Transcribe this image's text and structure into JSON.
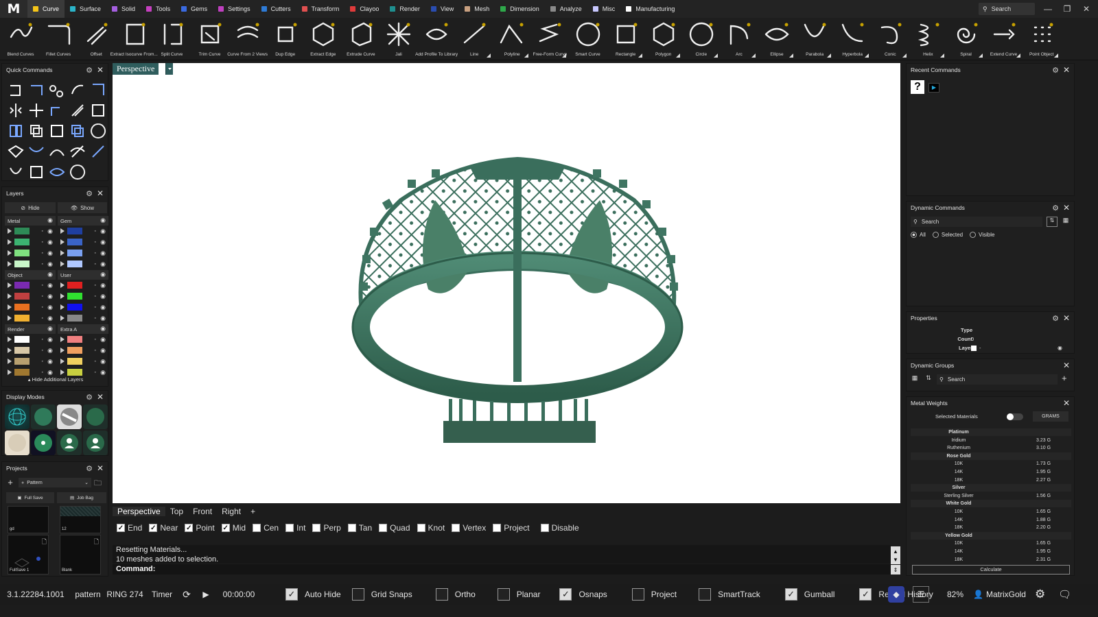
{
  "app": {
    "logo": "M"
  },
  "menu": [
    {
      "label": "Curve",
      "color": "#f5c518",
      "active": true
    },
    {
      "label": "Surface",
      "color": "#2bb4c9"
    },
    {
      "label": "Solid",
      "color": "#a55fe0"
    },
    {
      "label": "Tools",
      "color": "#c640c0"
    },
    {
      "label": "Gems",
      "color": "#3a6ae0"
    },
    {
      "label": "Settings",
      "color": "#c040c0"
    },
    {
      "label": "Cutters",
      "color": "#2e7bd6"
    },
    {
      "label": "Transform",
      "color": "#e05050"
    },
    {
      "label": "Clayoo",
      "color": "#e03b3b"
    },
    {
      "label": "Render",
      "color": "#1f8f8f"
    },
    {
      "label": "View",
      "color": "#2a4db0"
    },
    {
      "label": "Mesh",
      "color": "#c8a080"
    },
    {
      "label": "Dimension",
      "color": "#2ea84a"
    },
    {
      "label": "Analyze",
      "color": "#8a8a8a"
    },
    {
      "label": "Misc",
      "color": "#c8c8ff"
    },
    {
      "label": "Manufacturing",
      "color": "#ffffff"
    }
  ],
  "top_search": {
    "placeholder": "Search",
    "icon": "search-icon"
  },
  "toolbar": [
    {
      "label": "Blend Curves",
      "icon": "blend-curves-icon",
      "corner": false
    },
    {
      "label": "Fillet Curves",
      "icon": "fillet-curves-icon",
      "corner": false
    },
    {
      "label": "Offset",
      "icon": "offset-icon",
      "corner": false
    },
    {
      "label": "Extract Isocurve From...",
      "icon": "extract-isocurve-icon",
      "corner": false
    },
    {
      "label": "Split Curve",
      "icon": "split-curve-icon",
      "corner": false
    },
    {
      "label": "Trim Curve",
      "icon": "trim-curve-icon",
      "corner": false
    },
    {
      "label": "Curve From 2 Views",
      "icon": "curve-from-2-views-icon",
      "corner": false
    },
    {
      "label": "Dup Edge",
      "icon": "dup-edge-icon",
      "corner": false
    },
    {
      "label": "Extract Edge",
      "icon": "extract-edge-icon",
      "corner": false
    },
    {
      "label": "Extrude Curve",
      "icon": "extrude-curve-icon",
      "corner": false
    },
    {
      "label": "Jali",
      "icon": "jali-icon",
      "corner": false
    },
    {
      "label": "Add Profile To Library",
      "icon": "add-profile-icon",
      "corner": false
    },
    {
      "label": "Line",
      "icon": "line-icon",
      "corner": true
    },
    {
      "label": "Polyline",
      "icon": "polyline-icon",
      "corner": true
    },
    {
      "label": "Free-Form Curve",
      "icon": "free-form-curve-icon",
      "corner": true
    },
    {
      "label": "Smart Curve",
      "icon": "smart-curve-icon",
      "corner": false
    },
    {
      "label": "Rectangle",
      "icon": "rectangle-icon",
      "corner": true
    },
    {
      "label": "Polygon",
      "icon": "polygon-icon",
      "corner": true
    },
    {
      "label": "Circle",
      "icon": "circle-icon",
      "corner": true
    },
    {
      "label": "Arc",
      "icon": "arc-icon",
      "corner": true
    },
    {
      "label": "Ellipse",
      "icon": "ellipse-icon",
      "corner": true
    },
    {
      "label": "Parabola",
      "icon": "parabola-icon",
      "corner": true
    },
    {
      "label": "Hyperbola",
      "icon": "hyperbola-icon",
      "corner": true
    },
    {
      "label": "Conic",
      "icon": "conic-icon",
      "corner": true
    },
    {
      "label": "Helix",
      "icon": "helix-icon",
      "corner": true
    },
    {
      "label": "Spiral",
      "icon": "spiral-icon",
      "corner": true
    },
    {
      "label": "Extend Curve",
      "icon": "extend-curve-icon",
      "corner": true
    },
    {
      "label": "Point Object",
      "icon": "point-object-icon",
      "corner": true
    }
  ],
  "quick_commands": {
    "title": "Quick Commands"
  },
  "layers": {
    "title": "Layers",
    "hide": "Hide",
    "show": "Show",
    "footer": "Hide Additional Layers",
    "groups": [
      {
        "name": "Metal",
        "colors": [
          "#2e8b57",
          "#3cb371",
          "#7fe07f",
          "#c8f5c8"
        ]
      },
      {
        "name": "Gem",
        "colors": [
          "#1f3fa0",
          "#3a64c8",
          "#7aa0f0",
          "#b0c8ff"
        ]
      },
      {
        "name": "Object",
        "colors": [
          "#7a2ab0",
          "#c04040",
          "#e87020",
          "#f0b030"
        ]
      },
      {
        "name": "User",
        "colors": [
          "#e02020",
          "#30e030",
          "#1010f0",
          "#888888"
        ]
      },
      {
        "name": "Render",
        "colors": [
          "#ffffff",
          "#d8c8a8",
          "#b8a070",
          "#a07830"
        ]
      },
      {
        "name": "Extra A",
        "colors": [
          "#f08080",
          "#f0a060",
          "#f0d060",
          "#c8d040"
        ]
      }
    ]
  },
  "display_modes": {
    "title": "Display Modes"
  },
  "projects": {
    "title": "Projects",
    "dropdown": "Pattern",
    "full_save": "Full Save",
    "job_bag": "Job Bag",
    "thumbs": [
      {
        "label": "gd"
      },
      {
        "label": "12"
      },
      {
        "label": "FullSave 1"
      },
      {
        "label": "Blank"
      }
    ]
  },
  "viewport": {
    "active_tab": "Perspective",
    "tabs": [
      "Perspective",
      "Top",
      "Front",
      "Right",
      "+"
    ]
  },
  "snaps": [
    {
      "label": "End",
      "checked": true
    },
    {
      "label": "Near",
      "checked": true
    },
    {
      "label": "Point",
      "checked": true
    },
    {
      "label": "Mid",
      "checked": true
    },
    {
      "label": "Cen",
      "checked": false
    },
    {
      "label": "Int",
      "checked": false
    },
    {
      "label": "Perp",
      "checked": false
    },
    {
      "label": "Tan",
      "checked": false
    },
    {
      "label": "Quad",
      "checked": false
    },
    {
      "label": "Knot",
      "checked": false
    },
    {
      "label": "Vertex",
      "checked": false
    },
    {
      "label": "Project",
      "checked": false
    },
    {
      "label": "Disable",
      "checked": false
    }
  ],
  "command": {
    "history": [
      "Resetting Materials...",
      "10 meshes added to selection."
    ],
    "prompt": "Command:"
  },
  "right": {
    "recent_title": "Recent Commands",
    "dynamic_title": "Dynamic Commands",
    "dynamic_search": "Search",
    "radio": [
      "All",
      "Selected",
      "Visible"
    ],
    "properties_title": "Properties",
    "props": [
      {
        "k": "Type",
        "v": "-"
      },
      {
        "k": "Count",
        "v": "0"
      },
      {
        "k": "Layer",
        "v": "-"
      }
    ],
    "groups_title": "Dynamic Groups",
    "groups_search": "Search",
    "metal_title": "Metal Weights",
    "selected_materials": "Selected Materials",
    "grams": "GRAMS",
    "metals": [
      {
        "n": "Platinum",
        "h": true
      },
      {
        "n": "Iridium",
        "v": "3.23 G"
      },
      {
        "n": "Ruthenium",
        "v": "3.10 G"
      },
      {
        "n": "Rose Gold",
        "h": true
      },
      {
        "n": "10K",
        "v": "1.73 G"
      },
      {
        "n": "14K",
        "v": "1.95 G"
      },
      {
        "n": "18K",
        "v": "2.27 G"
      },
      {
        "n": "Silver",
        "h": true
      },
      {
        "n": "Sterling Silver",
        "v": "1.56 G"
      },
      {
        "n": "White Gold",
        "h": true
      },
      {
        "n": "10K",
        "v": "1.65 G"
      },
      {
        "n": "14K",
        "v": "1.88 G"
      },
      {
        "n": "18K",
        "v": "2.20 G"
      },
      {
        "n": "Yellow Gold",
        "h": true
      },
      {
        "n": "10K",
        "v": "1.65 G"
      },
      {
        "n": "14K",
        "v": "1.95 G"
      },
      {
        "n": "18K",
        "v": "2.31 G"
      }
    ],
    "calculate": "Calculate"
  },
  "status": {
    "version": "3.1.22284.1001",
    "file": "pattern",
    "ring": "RING 274",
    "timer": "Timer",
    "time": "00:00:00",
    "toggles": [
      {
        "label": "Auto Hide",
        "on": true
      },
      {
        "label": "Grid Snaps",
        "on": false
      },
      {
        "label": "Ortho",
        "on": false
      },
      {
        "label": "Planar",
        "on": false
      },
      {
        "label": "Osnaps",
        "on": true
      },
      {
        "label": "Project",
        "on": false
      },
      {
        "label": "SmartTrack",
        "on": false
      },
      {
        "label": "Gumball",
        "on": true
      },
      {
        "label": "Record History",
        "on": true
      }
    ],
    "zoom": "82%",
    "user": "MatrixGold"
  },
  "colors": {
    "accent": "#2f5d5d",
    "ring": "#3a6e5c"
  }
}
